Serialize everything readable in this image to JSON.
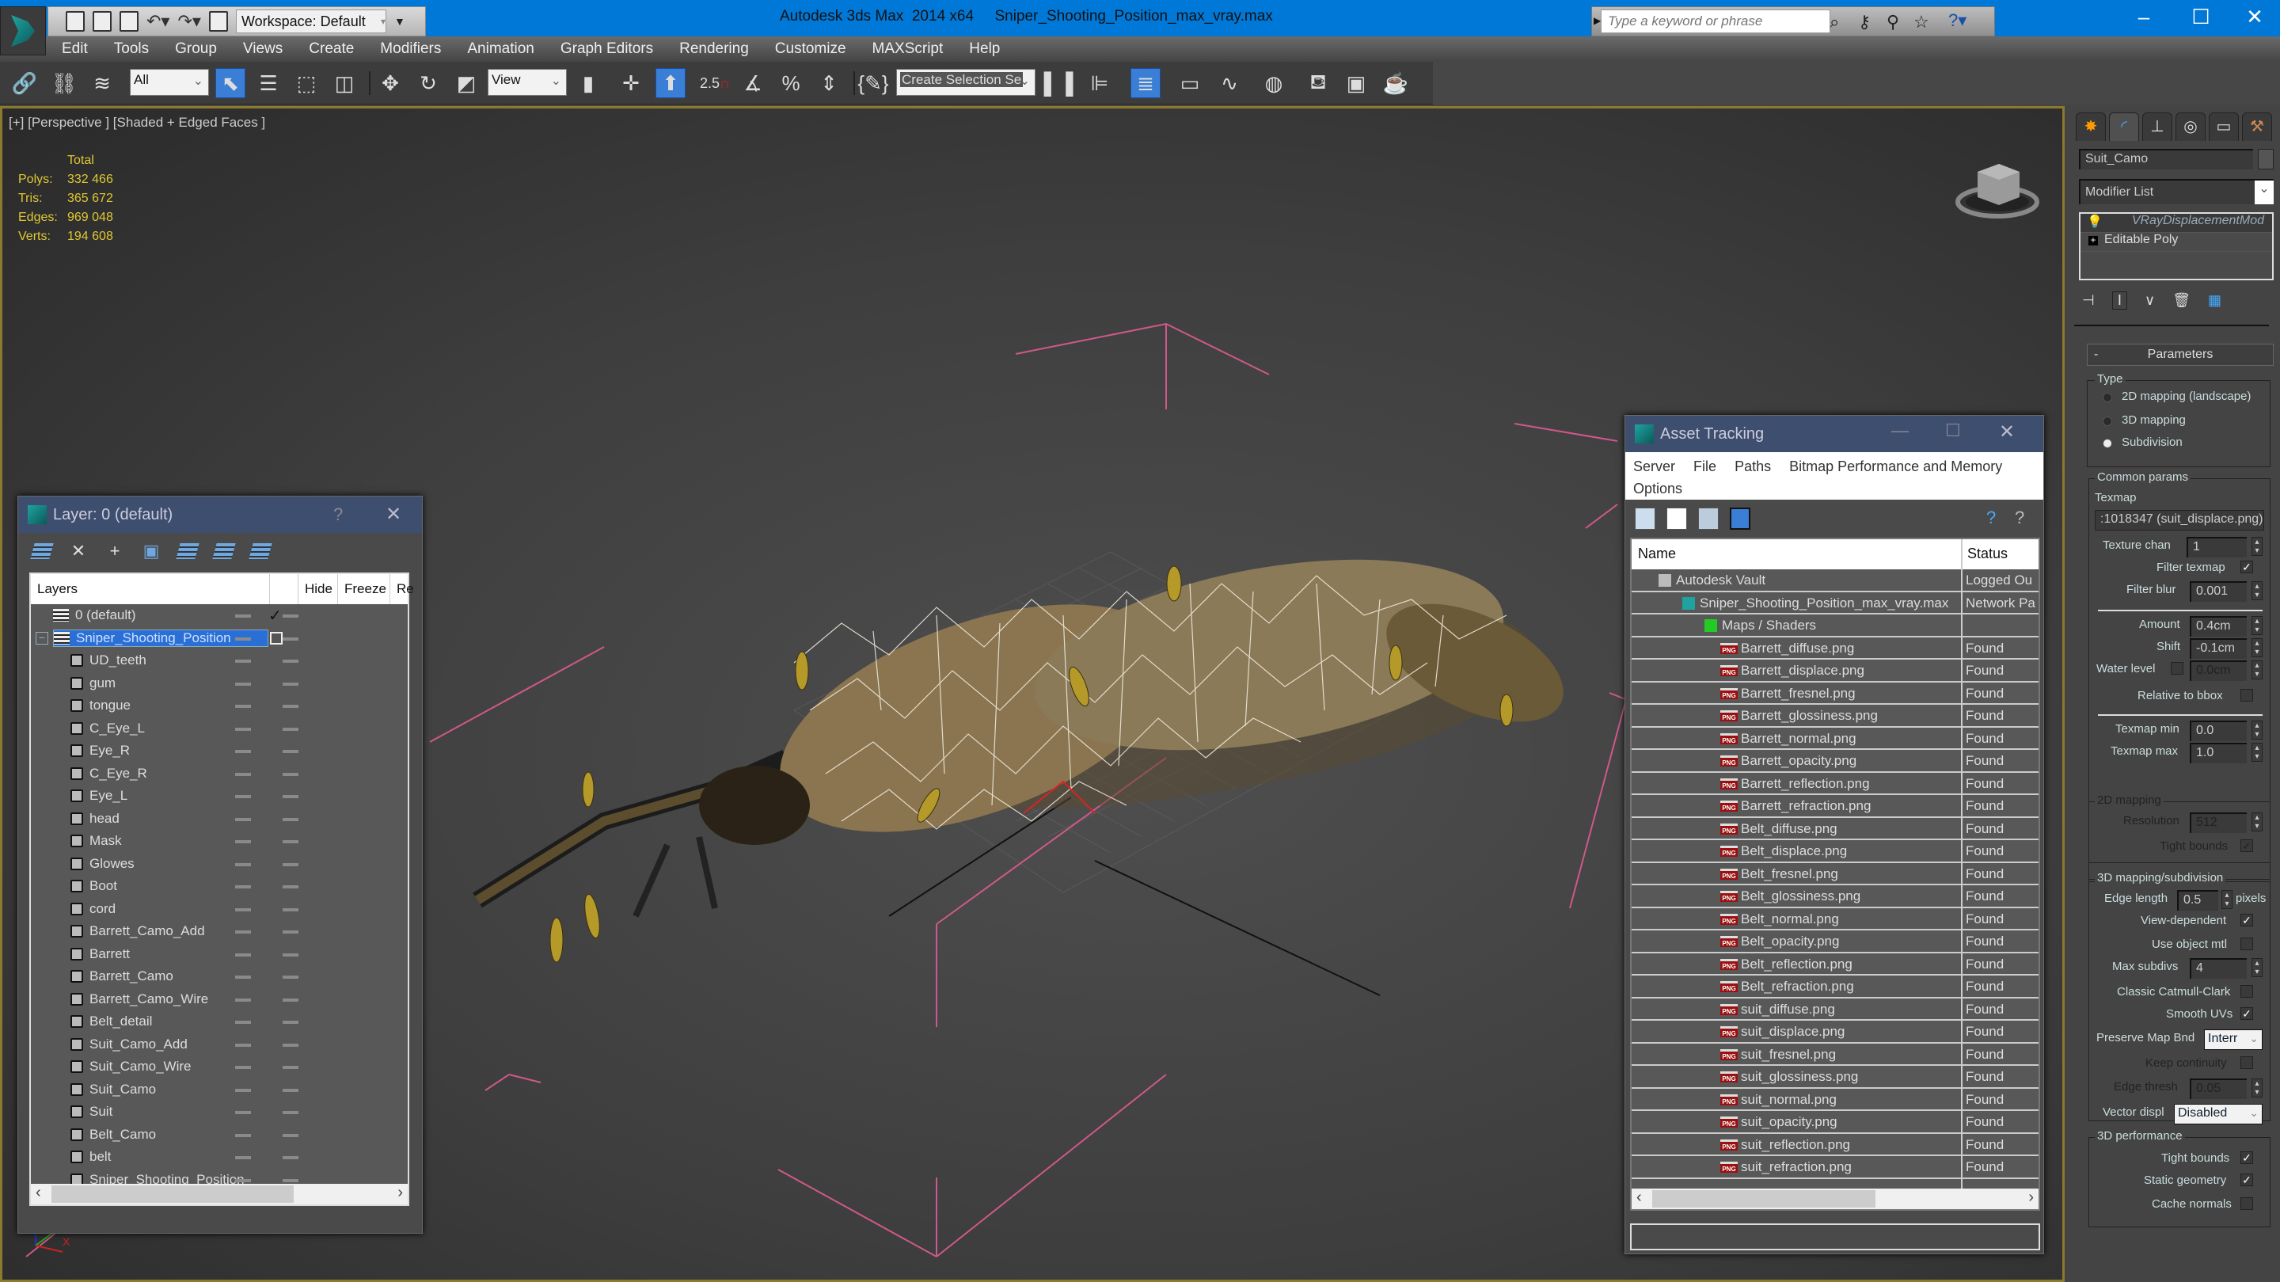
{
  "titlebar": {
    "app_title": "Autodesk 3ds Max  2014 x64",
    "file_name": "Sniper_Shooting_Position_max_vray.max",
    "workspace_label": "Workspace: Default",
    "search_placeholder": "Type a keyword or phrase",
    "minimize_glyph": "–",
    "maximize_glyph": "☐",
    "close_glyph": "✕",
    "search_tools": [
      "binoculars-icon",
      "key-icon",
      "satellite-icon",
      "star-icon",
      "help-icon"
    ]
  },
  "menubar": {
    "items": [
      "Edit",
      "Tools",
      "Group",
      "Views",
      "Create",
      "Modifiers",
      "Animation",
      "Graph Editors",
      "Rendering",
      "Customize",
      "MAXScript",
      "Help"
    ]
  },
  "toolbar": {
    "selection_filter": "All",
    "reference_coord": "View",
    "named_selection_placeholder": "Create Selection Se",
    "snap_value_label": "2.5"
  },
  "viewport": {
    "label": "[+] [Perspective ] [Shaded + Edged Faces ]",
    "stats": {
      "header": "Total",
      "rows": [
        {
          "label": "Polys:",
          "value": "332 466"
        },
        {
          "label": "Tris:",
          "value": "365 672"
        },
        {
          "label": "Edges:",
          "value": "969 048"
        },
        {
          "label": "Verts:",
          "value": "194 608"
        }
      ]
    },
    "axis_label_x": "X"
  },
  "layer_dialog": {
    "title": "Layer: 0 (default)",
    "help_glyph": "?",
    "close_glyph": "✕",
    "columns": [
      "Layers",
      "",
      "Hide",
      "Freeze",
      "Re"
    ],
    "layers": [
      {
        "name": "0 (default)",
        "type": "layer",
        "current": true
      },
      {
        "name": "Sniper_Shooting_Position",
        "type": "layer",
        "selected": true,
        "expanded": true
      }
    ],
    "objects": [
      "UD_teeth",
      "gum",
      "tongue",
      "C_Eye_L",
      "Eye_R",
      "C_Eye_R",
      "Eye_L",
      "head",
      "Mask",
      "Glowes",
      "Boot",
      "cord",
      "Barrett_Camo_Add",
      "Barrett",
      "Barrett_Camo",
      "Barrett_Camo_Wire",
      "Belt_detail",
      "Suit_Camo_Add",
      "Suit_Camo_Wire",
      "Suit_Camo",
      "Suit",
      "Belt_Camo",
      "belt",
      "Sniper_Shooting_Position"
    ]
  },
  "asset_dialog": {
    "title": "Asset Tracking",
    "menu": [
      "Server",
      "File",
      "Paths",
      "Bitmap Performance and Memory",
      "Options"
    ],
    "columns": [
      "Name",
      "Status"
    ],
    "tree": [
      {
        "name": "Autodesk Vault",
        "status": "Logged Ou",
        "level": 0,
        "icon": "vault-icon"
      },
      {
        "name": "Sniper_Shooting_Position_max_vray.max",
        "status": "Network Pa",
        "level": 1,
        "icon": "max-file-icon"
      },
      {
        "name": "Maps / Shaders",
        "status": "",
        "level": 2,
        "icon": "maps-icon"
      }
    ],
    "files": [
      {
        "name": "Barrett_diffuse.png",
        "status": "Found"
      },
      {
        "name": "Barrett_displace.png",
        "status": "Found"
      },
      {
        "name": "Barrett_fresnel.png",
        "status": "Found"
      },
      {
        "name": "Barrett_glossiness.png",
        "status": "Found"
      },
      {
        "name": "Barrett_normal.png",
        "status": "Found"
      },
      {
        "name": "Barrett_opacity.png",
        "status": "Found"
      },
      {
        "name": "Barrett_reflection.png",
        "status": "Found"
      },
      {
        "name": "Barrett_refraction.png",
        "status": "Found"
      },
      {
        "name": "Belt_diffuse.png",
        "status": "Found"
      },
      {
        "name": "Belt_displace.png",
        "status": "Found"
      },
      {
        "name": "Belt_fresnel.png",
        "status": "Found"
      },
      {
        "name": "Belt_glossiness.png",
        "status": "Found"
      },
      {
        "name": "Belt_normal.png",
        "status": "Found"
      },
      {
        "name": "Belt_opacity.png",
        "status": "Found"
      },
      {
        "name": "Belt_reflection.png",
        "status": "Found"
      },
      {
        "name": "Belt_refraction.png",
        "status": "Found"
      },
      {
        "name": "suit_diffuse.png",
        "status": "Found"
      },
      {
        "name": "suit_displace.png",
        "status": "Found"
      },
      {
        "name": "suit_fresnel.png",
        "status": "Found"
      },
      {
        "name": "suit_glossiness.png",
        "status": "Found"
      },
      {
        "name": "suit_normal.png",
        "status": "Found"
      },
      {
        "name": "suit_opacity.png",
        "status": "Found"
      },
      {
        "name": "suit_reflection.png",
        "status": "Found"
      },
      {
        "name": "suit_refraction.png",
        "status": "Found"
      }
    ],
    "png_badge": "PNG"
  },
  "command_panel": {
    "tabs": [
      "create-icon",
      "modify-icon",
      "hierarchy-icon",
      "motion-icon",
      "display-icon",
      "utilities-icon"
    ],
    "object_name": "Suit_Camo",
    "modifier_list_label": "Modifier List",
    "stack": [
      {
        "name": "VRayDisplacementMod",
        "italic": true
      },
      {
        "name": "Editable Poly",
        "italic": false
      }
    ],
    "rollout_title": "Parameters",
    "rollout_toggle": "-",
    "type_group": {
      "title": "Type",
      "options": [
        "2D mapping (landscape)",
        "3D mapping",
        "Subdivision"
      ],
      "selected_index": 2
    },
    "common_group": {
      "title": "Common params",
      "texmap_label": "Texmap",
      "texmap_value": ":1018347 (suit_displace.png)",
      "texture_chan_label": "Texture chan",
      "texture_chan_value": "1",
      "filter_texmap_label": "Filter texmap",
      "filter_texmap_checked": true,
      "filter_blur_label": "Filter blur",
      "filter_blur_value": "0.001",
      "amount_label": "Amount",
      "amount_value": "0.4cm",
      "shift_label": "Shift",
      "shift_value": "-0.1cm",
      "water_level_label": "Water level",
      "water_level_checked": false,
      "water_level_value": "0.0cm",
      "relative_bbox_label": "Relative to bbox",
      "relative_bbox_checked": false,
      "texmap_min_label": "Texmap min",
      "texmap_min_value": "0.0",
      "texmap_max_label": "Texmap max",
      "texmap_max_value": "1.0"
    },
    "mapping2d_group": {
      "title": "2D mapping",
      "resolution_label": "Resolution",
      "resolution_value": "512",
      "tight_bounds_label": "Tight bounds",
      "tight_bounds_checked": true
    },
    "mapping3d_group": {
      "title": "3D mapping/subdivision",
      "edge_length_label": "Edge length",
      "edge_length_value": "0.5",
      "edge_length_unit": "pixels",
      "view_dependent_label": "View-dependent",
      "view_dependent_checked": true,
      "use_object_mtl_label": "Use object mtl",
      "use_object_mtl_checked": false,
      "max_subdivs_label": "Max subdivs",
      "max_subdivs_value": "4",
      "catmull_label": "Classic Catmull-Clark",
      "catmull_checked": false,
      "smooth_uvs_label": "Smooth UVs",
      "smooth_uvs_checked": true,
      "preserve_map_label": "Preserve Map Bnd",
      "preserve_map_value": "Interr",
      "keep_continuity_label": "Keep continuity",
      "keep_continuity_checked": false,
      "edge_thresh_label": "Edge thresh",
      "edge_thresh_value": "0.05",
      "vector_displ_label": "Vector displ",
      "vector_displ_value": "Disabled"
    },
    "performance_group": {
      "title": "3D performance",
      "tight_bounds_label": "Tight bounds",
      "tight_bounds_checked": true,
      "static_geometry_label": "Static geometry",
      "static_geometry_checked": true,
      "cache_normals_label": "Cache normals",
      "cache_normals_checked": false
    }
  },
  "colors": {
    "title_blue": "#0078d7",
    "selection_blue": "#2a6fd6",
    "stats_yellow": "#e0c832",
    "viewport_border": "#8b7a2e",
    "bbox_pink": "#d0588a"
  }
}
